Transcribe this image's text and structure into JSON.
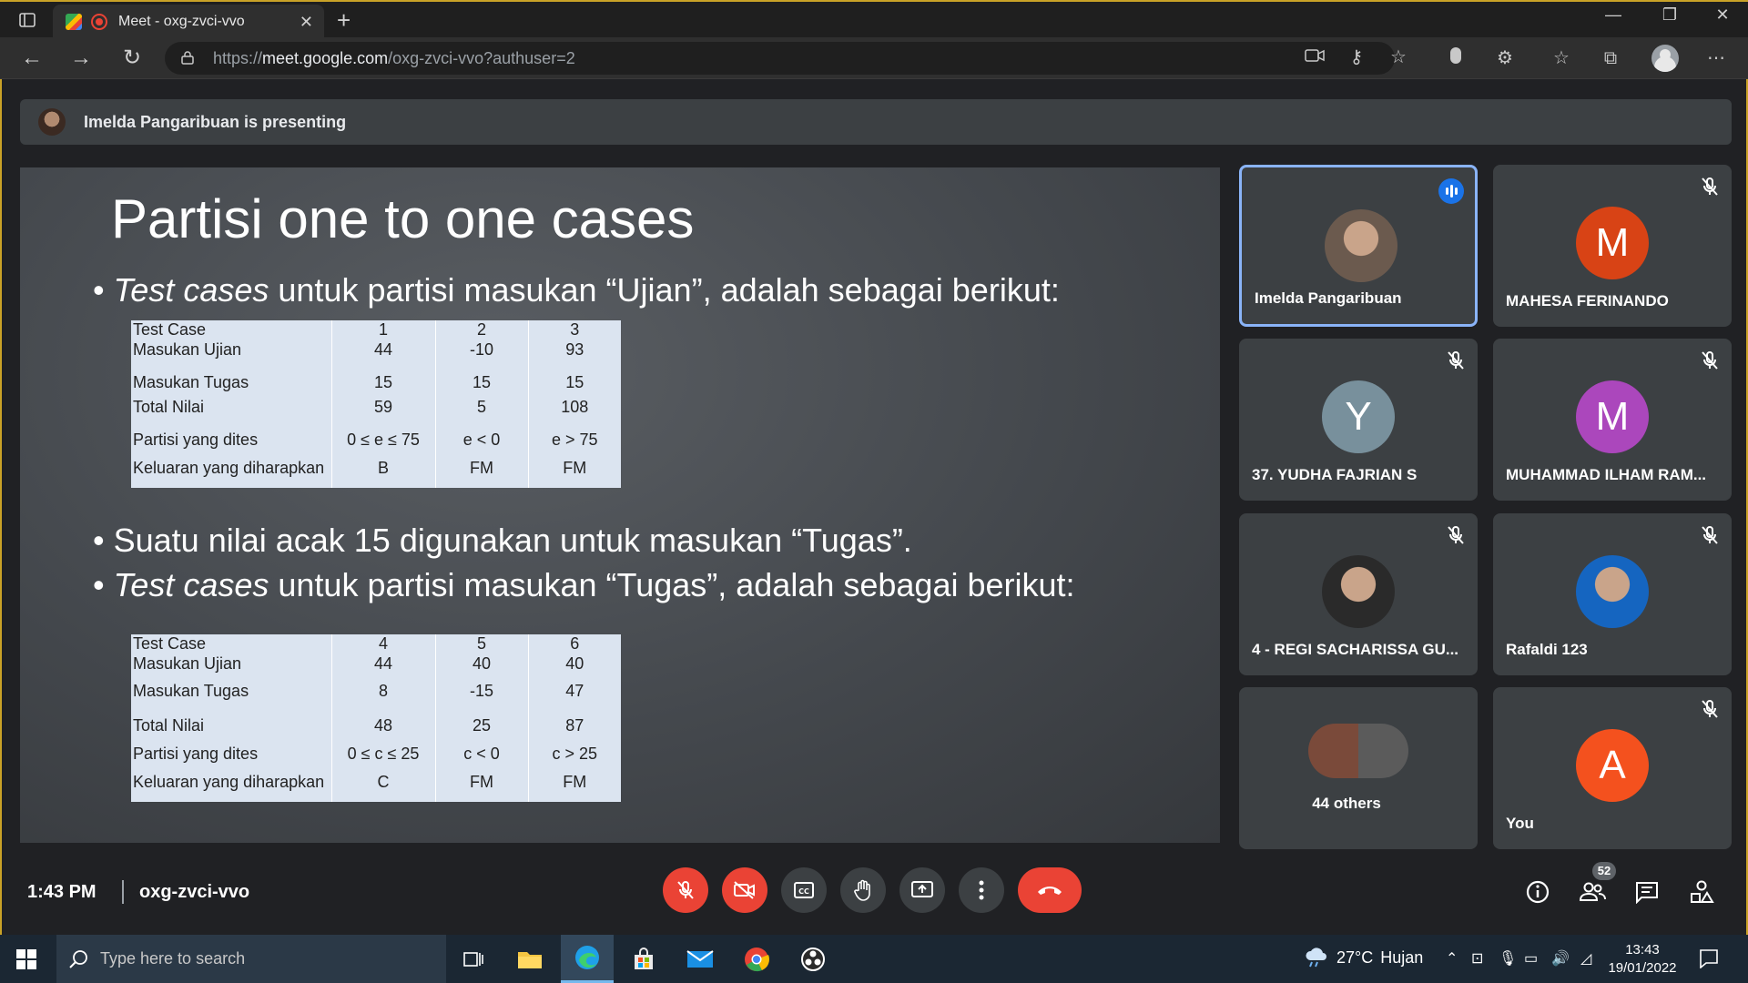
{
  "browser": {
    "tab_title": "Meet - oxg-zvci-vvo",
    "url_prefix": "https://",
    "url_host": "meet.google.com",
    "url_path": "/oxg-zvci-vvo?authuser=2"
  },
  "meet": {
    "presenting_text": "Imelda Pangaribuan is presenting",
    "clock": "1:43 PM",
    "meeting_code": "oxg-zvci-vvo",
    "people_count": "52"
  },
  "slide": {
    "title": "Partisi one to one cases",
    "bullet1_italic": "Test cases",
    "bullet1_rest": " untuk partisi masukan “Ujian”, adalah sebagai berikut:",
    "bullet2": "Suatu nilai acak 15 digunakan untuk masukan “Tugas”.",
    "bullet3_italic": "Test cases",
    "bullet3_rest": " untuk partisi masukan “Tugas”, adalah sebagai berikut:",
    "table1": [
      [
        "Test Case",
        "1",
        "2",
        "3"
      ],
      [
        "Masukan Ujian",
        "44",
        "-10",
        "93"
      ],
      [
        "Masukan Tugas",
        "15",
        "15",
        "15"
      ],
      [
        "Total Nilai",
        "59",
        "5",
        "108"
      ],
      [
        "Partisi yang dites",
        "0 ≤ e ≤ 75",
        "e < 0",
        "e > 75"
      ],
      [
        "Keluaran yang diharapkan",
        "B",
        "FM",
        "FM"
      ]
    ],
    "table2": [
      [
        "Test Case",
        "4",
        "5",
        "6"
      ],
      [
        "Masukan Ujian",
        "44",
        "40",
        "40"
      ],
      [
        "Masukan Tugas",
        "8",
        "-15",
        "47"
      ],
      [
        "Total Nilai",
        "48",
        "25",
        "87"
      ],
      [
        "Partisi yang dites",
        "0 ≤ c ≤ 25",
        "c < 0",
        "c > 25"
      ],
      [
        "Keluaran yang diharapkan",
        "C",
        "FM",
        "FM"
      ]
    ]
  },
  "participants": [
    {
      "name": "Imelda Pangaribuan",
      "initial": "",
      "color": "#6b5a4e",
      "speaking": true,
      "muted": false
    },
    {
      "name": "MAHESA FERINANDO",
      "initial": "M",
      "color": "#d84315",
      "speaking": false,
      "muted": true
    },
    {
      "name": "37. YUDHA FAJRIAN S",
      "initial": "Y",
      "color": "#78909c",
      "speaking": false,
      "muted": true
    },
    {
      "name": "MUHAMMAD ILHAM RAM...",
      "initial": "M",
      "color": "#ab47bc",
      "speaking": false,
      "muted": true
    },
    {
      "name": "4 - REGI SACHARISSA GU...",
      "initial": "",
      "color": "#2a2a2a",
      "speaking": false,
      "muted": true
    },
    {
      "name": "Rafaldi 123",
      "initial": "",
      "color": "#1565c0",
      "speaking": false,
      "muted": true
    },
    {
      "name": "44 others",
      "initial": "",
      "color": "#5f6368",
      "speaking": false,
      "muted": false
    },
    {
      "name": "You",
      "initial": "A",
      "color": "#f4511e",
      "speaking": false,
      "muted": true
    }
  ],
  "taskbar": {
    "search_placeholder": "Type here to search",
    "temperature": "27°C",
    "weather": "Hujan",
    "time": "13:43",
    "date": "19/01/2022"
  },
  "colors": {
    "meet_bg": "#202124",
    "tile_bg": "#3c4043",
    "end_call_red": "#ea4335",
    "active_speaker_border": "#8ab4f8"
  }
}
